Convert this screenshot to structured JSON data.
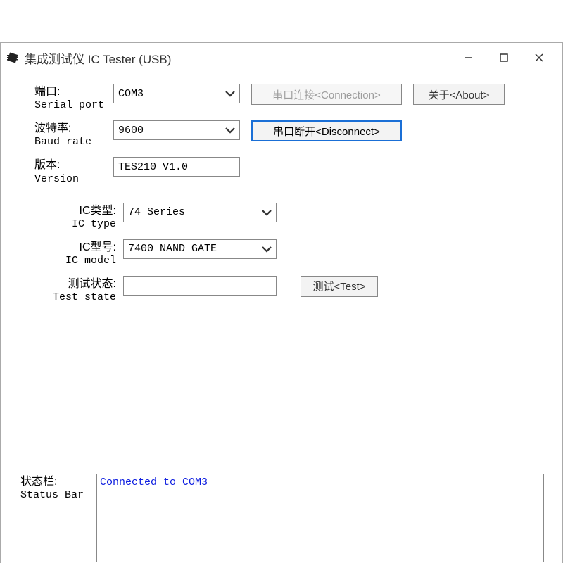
{
  "window": {
    "title": "集成测试仪 IC Tester (USB)"
  },
  "labels": {
    "port_cn": "端口:",
    "port_en": "Serial port",
    "baud_cn": "波特率:",
    "baud_en": "Baud rate",
    "version_cn": "版本:",
    "version_en": "Version",
    "ictype_cn": "IC类型:",
    "ictype_en": "IC type",
    "icmodel_cn": "IC型号:",
    "icmodel_en": "IC model",
    "teststate_cn": "测试状态:",
    "teststate_en": "Test state",
    "statusbar_cn": "状态栏:",
    "statusbar_en": "Status Bar"
  },
  "values": {
    "port": "COM3",
    "baud": "9600",
    "version": "TES210 V1.0",
    "ictype": "74 Series",
    "icmodel": "7400 NAND GATE",
    "teststate": "",
    "status_text": "Connected to COM3"
  },
  "buttons": {
    "connect": "串口连接<Connection>",
    "about": "关于<About>",
    "disconnect": "串口断开<Disconnect>",
    "test": "测试<Test>"
  }
}
